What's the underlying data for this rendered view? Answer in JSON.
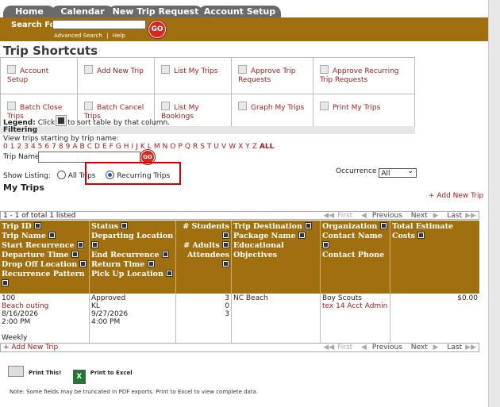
{
  "tabs": [
    "Home",
    "Calendar",
    "New Trip Request",
    "Account Setup"
  ],
  "search": {
    "label": "Search For:",
    "value": "",
    "go": "GO",
    "advanced": "Advanced Search",
    "sep": "|",
    "help": "Help"
  },
  "shortcuts_title": "Trip Shortcuts",
  "shortcuts": [
    [
      "Account Setup",
      "Add New Trip",
      "List My Trips",
      "Approve Trip Requests",
      "Approve Recurring Trip Requests"
    ],
    [
      "Batch Close Trips",
      "Batch Cancel Trips",
      "List My Bookings",
      "Graph My Trips",
      "Print My Trips"
    ]
  ],
  "legend": {
    "label": "Legend:",
    "pre": "Click",
    "post": "to sort table by that column."
  },
  "filtering": "Filtering",
  "view_trips": "View trips starting by trip name:",
  "letters": [
    "0",
    "1",
    "2",
    "3",
    "4",
    "5",
    "6",
    "7",
    "8",
    "9",
    "A",
    "B",
    "C",
    "D",
    "E",
    "F",
    "G",
    "H",
    "I",
    "J",
    "K",
    "L",
    "M",
    "N",
    "O",
    "P",
    "Q",
    "R",
    "S",
    "T",
    "U",
    "V",
    "W",
    "X",
    "Y",
    "Z"
  ],
  "all": "ALL",
  "trip_name_label": "Trip Name",
  "go": "GO",
  "show_listing": "Show Listing:",
  "opt_all": "All Trips",
  "opt_recurring": "Recurring Trips",
  "occurrence_label": "Occurrence",
  "occurrence_value": "All",
  "my_trips": "My Trips",
  "add_new_trip": "+ Add New Trip",
  "listed_text": "1 - 1 of total 1 listed",
  "pager": {
    "first": "First",
    "previous": "Previous",
    "next": "Next",
    "last": "Last"
  },
  "headers": {
    "c1": [
      "Trip ID",
      "Trip Name",
      "Start Recurrence",
      "Departure Time",
      "Drop Off Location",
      "Recurrence Pattern"
    ],
    "c2": [
      "Status",
      "Departing Location",
      "End Recurrence",
      "Return Time",
      "Pick Up Location"
    ],
    "c3": [
      "# Students",
      "# Adults",
      "Attendees"
    ],
    "c4": [
      "Trip Destination",
      "Package Name",
      "Educational Objectives"
    ],
    "c5": [
      "Organization",
      "Contact Name",
      "Contact Phone"
    ],
    "c6": [
      "Total Estimate Costs"
    ]
  },
  "row": {
    "trip_id": "100",
    "trip_name": "Beach outing",
    "start": "8/16/2026",
    "depart": "2:00 PM",
    "pattern": "Weekly",
    "status": "Approved",
    "departing": "KL",
    "end": "9/27/2026",
    "return": "4:00 PM",
    "students": "3",
    "adults": "0",
    "attendees": "3",
    "destination": "NC Beach",
    "organization": "Boy Scouts",
    "contact": "tex 14 Acct Admin",
    "cost": "$0.00"
  },
  "print_this": "Print This!",
  "print_excel": "Print to Excel",
  "note": "Note: Some fields may be truncated in PDF exports. Print to Excel to view complete data.",
  "colors": {
    "brand": "#a07010",
    "link": "#a01c1c",
    "highlight": "#d20000"
  }
}
